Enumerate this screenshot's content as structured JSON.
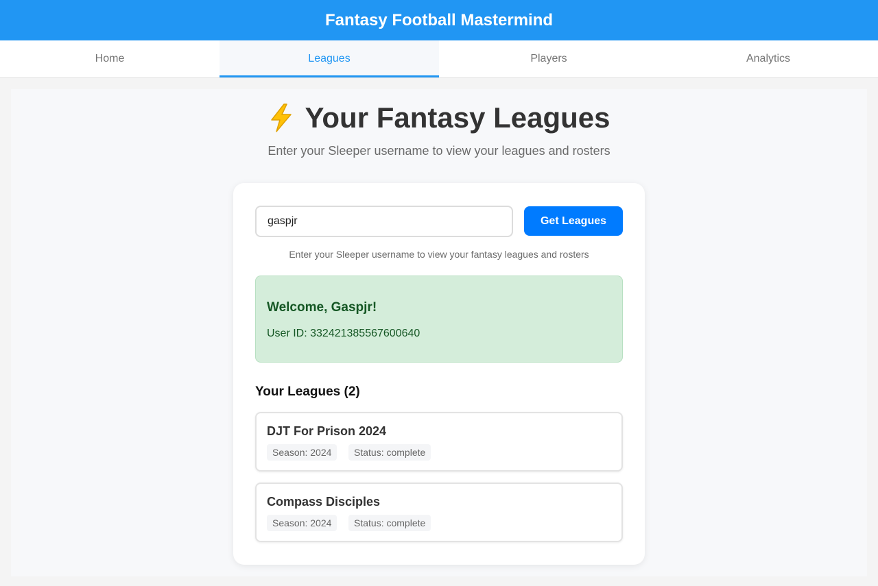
{
  "header": {
    "title": "Fantasy Football Mastermind"
  },
  "nav": {
    "tabs": [
      {
        "label": "Home"
      },
      {
        "label": "Leagues"
      },
      {
        "label": "Players"
      },
      {
        "label": "Analytics"
      }
    ],
    "active": "Leagues"
  },
  "page": {
    "title": "Your Fantasy Leagues",
    "icon": "lightning-bolt-icon",
    "subtitle": "Enter your Sleeper username to view your leagues and rosters"
  },
  "search": {
    "value": "gaspjr",
    "button_label": "Get Leagues",
    "helper": "Enter your Sleeper username to view your fantasy leagues and rosters"
  },
  "welcome": {
    "title": "Welcome, Gaspjr!",
    "user_id": "User ID: 332421385567600640"
  },
  "leagues": {
    "heading": "Your Leagues (2)",
    "items": [
      {
        "name": "DJT For Prison 2024",
        "season": "Season: 2024",
        "status": "Status: complete"
      },
      {
        "name": "Compass Disciples",
        "season": "Season: 2024",
        "status": "Status: complete"
      }
    ]
  },
  "colors": {
    "primary": "#2196f3",
    "button": "#007bff",
    "success_bg": "#d4edda",
    "success_text": "#155724"
  }
}
